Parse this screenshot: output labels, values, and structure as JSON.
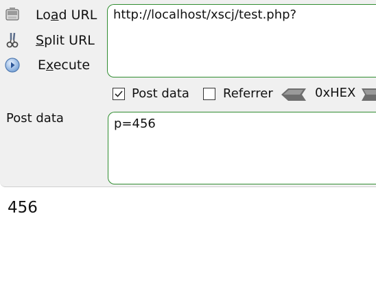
{
  "toolbar": {
    "actions": [
      {
        "label_pre": "Lo",
        "label_key": "a",
        "label_post": "d URL",
        "icon": "load-url-icon"
      },
      {
        "label_pre": "",
        "label_key": "S",
        "label_post": "plit URL",
        "icon": "split-url-icon"
      },
      {
        "label_pre": "E",
        "label_key": "x",
        "label_post": "ecute",
        "icon": "execute-icon"
      }
    ],
    "url_value": "http://localhost/xscj/test.php?",
    "options": {
      "post_data_label": "Post data",
      "post_data_checked": true,
      "referrer_label": "Referrer",
      "referrer_checked": false,
      "hex_label": "0xHEX"
    },
    "post_data_caption": "Post data",
    "post_data_value": "p=456"
  },
  "page": {
    "result_text": "456"
  },
  "colors": {
    "panel_bg": "#f0f0f0",
    "field_border": "#2e8b2e",
    "page_bg": "#ffffff"
  }
}
